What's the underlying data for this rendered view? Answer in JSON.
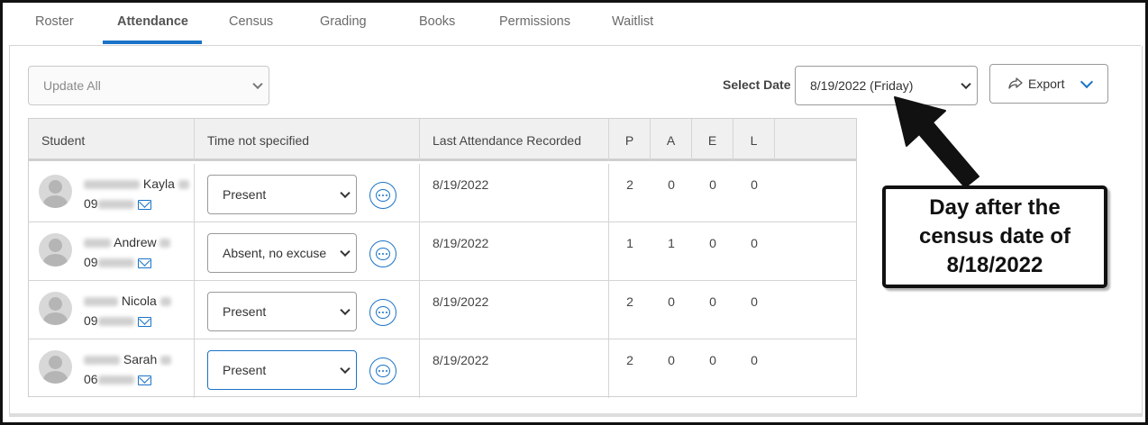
{
  "tabs": [
    {
      "label": "Roster"
    },
    {
      "label": "Attendance",
      "active": true
    },
    {
      "label": "Census"
    },
    {
      "label": "Grading"
    },
    {
      "label": "Books"
    },
    {
      "label": "Permissions"
    },
    {
      "label": "Waitlist"
    }
  ],
  "toolbar": {
    "update_all": "Update All",
    "select_date_label": "Select Date",
    "selected_date": "8/19/2022 (Friday)",
    "export_label": "Export"
  },
  "table": {
    "headers": {
      "student": "Student",
      "time": "Time not specified",
      "last": "Last Attendance Recorded",
      "p": "P",
      "a": "A",
      "e": "E",
      "l": "L"
    },
    "rows": [
      {
        "first_name": "Kayla",
        "id_prefix": "09",
        "status": "Present",
        "last_recorded": "8/19/2022",
        "p": "2",
        "a": "0",
        "e": "0",
        "l": "0"
      },
      {
        "first_name": "Andrew",
        "id_prefix": "09",
        "status": "Absent, no excuse",
        "last_recorded": "8/19/2022",
        "p": "1",
        "a": "1",
        "e": "0",
        "l": "0"
      },
      {
        "first_name": "Nicola",
        "id_prefix": "09",
        "status": "Present",
        "last_recorded": "8/19/2022",
        "p": "2",
        "a": "0",
        "e": "0",
        "l": "0"
      },
      {
        "first_name": "Sarah",
        "id_prefix": "06",
        "status": "Present",
        "last_recorded": "8/19/2022",
        "p": "2",
        "a": "0",
        "e": "0",
        "l": "0"
      }
    ]
  },
  "callout": {
    "text": "Day after the census date of 8/18/2022"
  },
  "colors": {
    "accent": "#1a73c7",
    "frame": "#111111"
  }
}
